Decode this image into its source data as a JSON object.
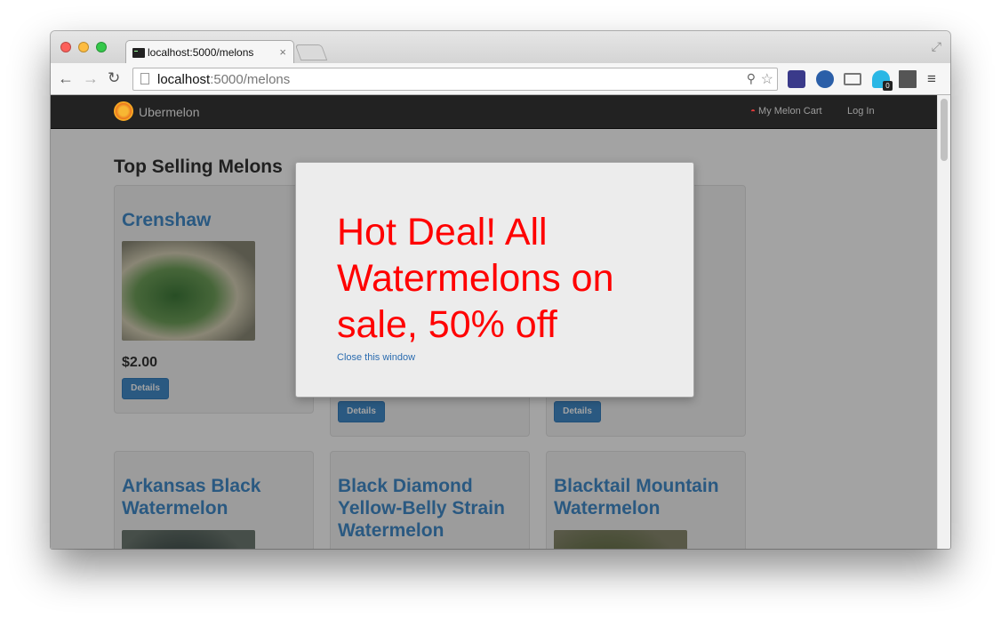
{
  "browser": {
    "tab_title": "localhost:5000/melons",
    "tab_close": "×",
    "url_host": "localhost",
    "url_rest": ":5000/melons",
    "extension_badge": "0"
  },
  "site": {
    "brand": "Ubermelon",
    "cart_link": "My Melon Cart",
    "login_link": "Log In"
  },
  "page": {
    "title": "Top Selling Melons",
    "melons": [
      {
        "name": "Crenshaw",
        "price": "$2.00",
        "button": "Details"
      },
      {
        "name": "",
        "price": "",
        "button": "Details"
      },
      {
        "name": "",
        "price": "",
        "button": "Details"
      },
      {
        "name": "Arkansas Black Watermelon",
        "price": "",
        "button": ""
      },
      {
        "name": "Black Diamond Yellow-Belly Strain Watermelon",
        "price": "",
        "button": ""
      },
      {
        "name": "Blacktail Mountain Watermelon",
        "price": "",
        "button": ""
      }
    ]
  },
  "modal": {
    "heading": "Hot Deal! All Watermelons on sale, 50% off",
    "close_link": "Close this window"
  },
  "colors": {
    "brand_blue": "#428bca",
    "deal_red": "#ff0000",
    "navbar_bg": "#222222"
  },
  "icons": {
    "back": "back-arrow-icon",
    "forward": "forward-arrow-icon",
    "reload": "reload-icon",
    "star": "bookmark-star-icon",
    "menu": "hamburger-menu-icon",
    "cart": "watermelon-slice-icon"
  }
}
